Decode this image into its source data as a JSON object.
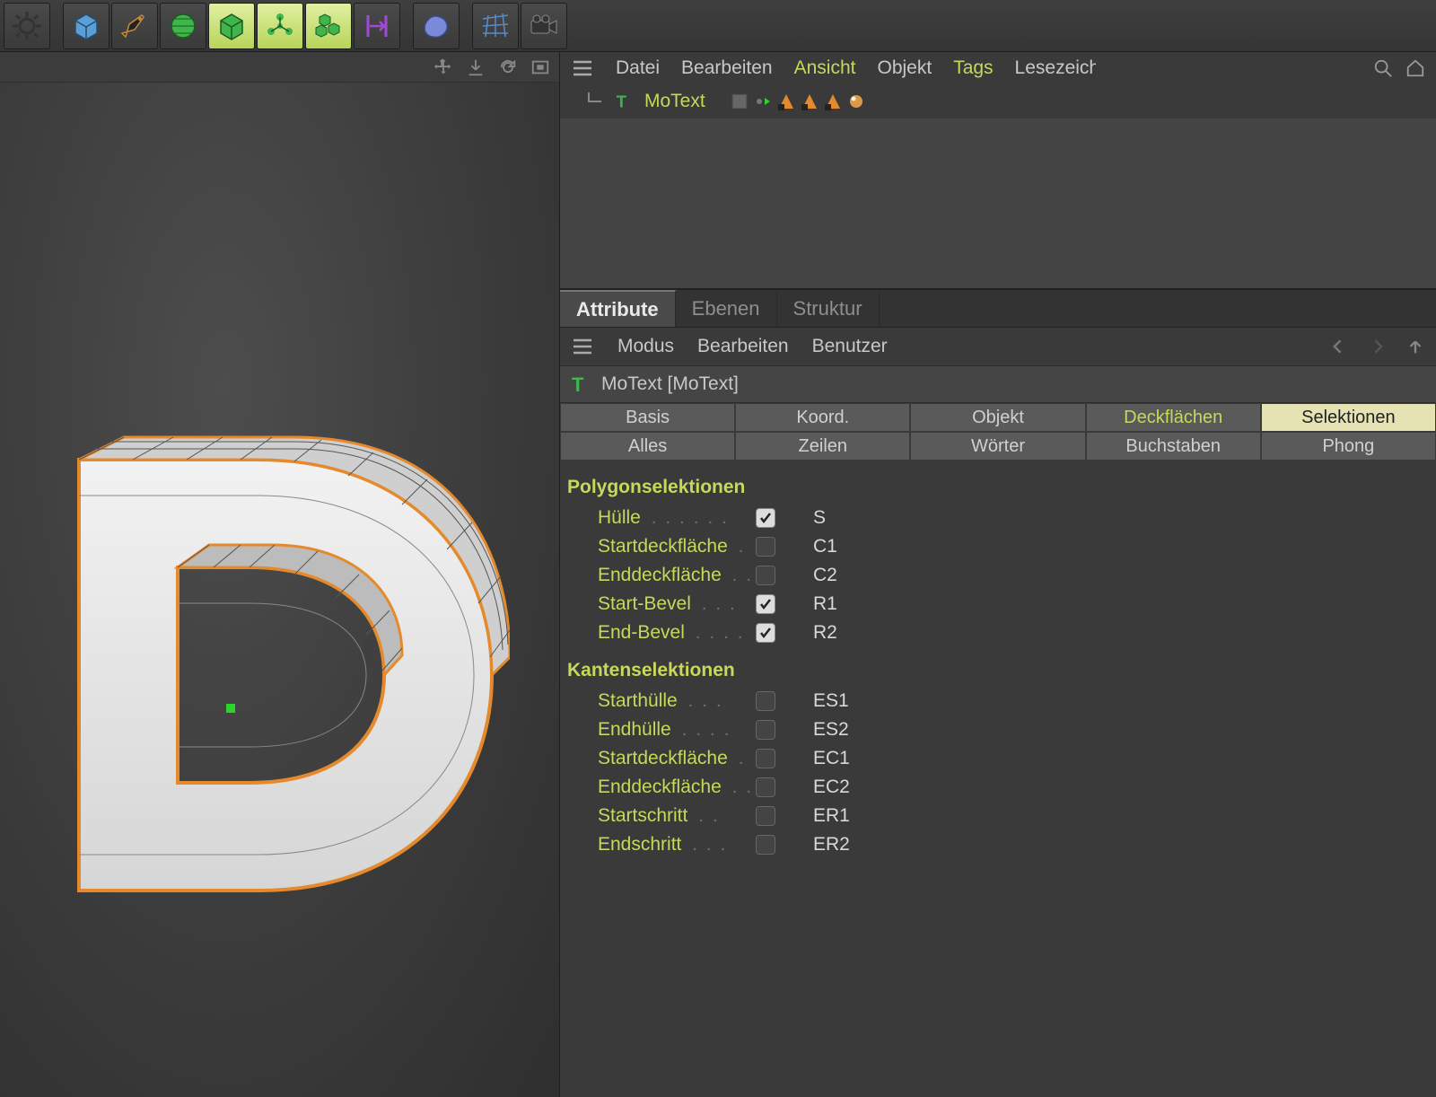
{
  "toolbar": {
    "icons": [
      "settings",
      "cube",
      "pen",
      "sphere-poly",
      "cube-green",
      "atoms",
      "cubes",
      "width",
      "blob",
      "grid",
      "camera"
    ],
    "active": [
      false,
      false,
      false,
      false,
      true,
      true,
      true,
      false,
      false,
      false,
      false
    ]
  },
  "viewport": {
    "icons": [
      "move",
      "down",
      "refresh",
      "frame"
    ]
  },
  "object_manager": {
    "menu": [
      "Datei",
      "Bearbeiten",
      "Ansicht",
      "Objekt",
      "Tags",
      "Lesezeichen"
    ],
    "menu_highlight": [
      false,
      false,
      true,
      false,
      true,
      false
    ],
    "right_icons": [
      "search",
      "home"
    ],
    "object_name": "MoText",
    "tags": [
      "layer",
      "vis-green",
      "tex1",
      "tex2",
      "tex3",
      "sphere"
    ]
  },
  "attribute_manager": {
    "panel_tabs": [
      "Attribute",
      "Ebenen",
      "Struktur"
    ],
    "panel_active": 0,
    "menu": [
      "Modus",
      "Bearbeiten",
      "Benutzer"
    ],
    "nav_icons": [
      "back",
      "forward",
      "up"
    ],
    "header": "MoText [MoText]",
    "attr_tabs_row1": [
      "Basis",
      "Koord.",
      "Objekt",
      "Deckflächen",
      "Selektionen"
    ],
    "attr_tabs_row1_hl": [
      false,
      false,
      false,
      true,
      true
    ],
    "attr_tabs_row1_sel": [
      false,
      false,
      false,
      false,
      true
    ],
    "attr_tabs_row2": [
      "Alles",
      "Zeilen",
      "Wörter",
      "Buchstaben",
      "Phong"
    ],
    "sections": {
      "poly_title": "Polygonselektionen",
      "poly": [
        {
          "label": "Hülle",
          "checked": true,
          "val": "S"
        },
        {
          "label": "Startdeckfläche",
          "checked": false,
          "val": "C1"
        },
        {
          "label": "Enddeckfläche",
          "checked": false,
          "val": "C2"
        },
        {
          "label": "Start-Bevel",
          "checked": true,
          "val": "R1"
        },
        {
          "label": "End-Bevel",
          "checked": true,
          "val": "R2"
        }
      ],
      "edge_title": "Kantenselektionen",
      "edge": [
        {
          "label": "Starthülle",
          "checked": false,
          "val": "ES1"
        },
        {
          "label": "Endhülle",
          "checked": false,
          "val": "ES2"
        },
        {
          "label": "Startdeckfläche",
          "checked": false,
          "val": "EC1"
        },
        {
          "label": "Enddeckfläche",
          "checked": false,
          "val": "EC2"
        },
        {
          "label": "Startschritt",
          "checked": false,
          "val": "ER1"
        },
        {
          "label": "Endschritt",
          "checked": false,
          "val": "ER2"
        }
      ]
    }
  }
}
